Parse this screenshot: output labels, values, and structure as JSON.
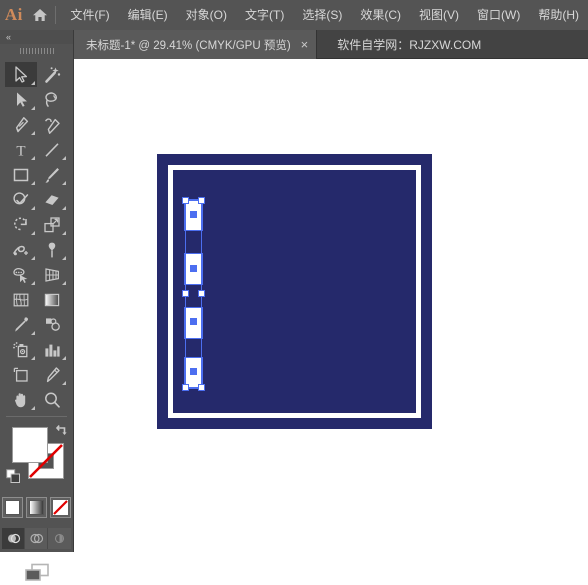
{
  "app": {
    "name": "Adobe Illustrator",
    "logo_text": "Ai",
    "home_icon": "home-icon"
  },
  "menubar": {
    "items": [
      {
        "label": "文件(F)",
        "name": "menu-file"
      },
      {
        "label": "编辑(E)",
        "name": "menu-edit"
      },
      {
        "label": "对象(O)",
        "name": "menu-object"
      },
      {
        "label": "文字(T)",
        "name": "menu-type"
      },
      {
        "label": "选择(S)",
        "name": "menu-select"
      },
      {
        "label": "效果(C)",
        "name": "menu-effect"
      },
      {
        "label": "视图(V)",
        "name": "menu-view"
      },
      {
        "label": "窗口(W)",
        "name": "menu-window"
      },
      {
        "label": "帮助(H)",
        "name": "menu-help"
      }
    ]
  },
  "tabbar": {
    "active_tab": {
      "title": "未标题-1* @ 29.41% (CMYK/GPU 预览)",
      "close_glyph": "×",
      "document_name": "未标题-1",
      "modified": true,
      "zoom": "29.41%",
      "color_mode": "CMYK",
      "preview": "GPU 预览"
    },
    "watermark": "软件自学网：RJZXW.COM"
  },
  "toolpanel": {
    "collapse_glyph": "«",
    "grip": "panel-grip",
    "tools": [
      {
        "name": "selection-tool",
        "label": "选择工具",
        "active": true,
        "corner": true
      },
      {
        "name": "magic-wand-tool",
        "label": "魔棒工具",
        "active": false,
        "corner": false
      },
      {
        "name": "direct-selection-tool",
        "label": "直接选择工具",
        "active": false,
        "corner": true
      },
      {
        "name": "lasso-tool",
        "label": "套索工具",
        "active": false,
        "corner": false
      },
      {
        "name": "pen-tool",
        "label": "钢笔工具",
        "active": false,
        "corner": true
      },
      {
        "name": "curvature-tool",
        "label": "曲率工具",
        "active": false,
        "corner": false
      },
      {
        "name": "type-tool",
        "label": "文字工具",
        "active": false,
        "corner": true
      },
      {
        "name": "line-segment-tool",
        "label": "直线段工具",
        "active": false,
        "corner": true
      },
      {
        "name": "rectangle-tool",
        "label": "矩形工具",
        "active": false,
        "corner": true
      },
      {
        "name": "paintbrush-tool",
        "label": "画笔工具",
        "active": false,
        "corner": true
      },
      {
        "name": "shaper-tool",
        "label": "Shaper 工具",
        "active": false,
        "corner": true
      },
      {
        "name": "eraser-tool",
        "label": "橡皮擦工具",
        "active": false,
        "corner": true
      },
      {
        "name": "rotate-tool",
        "label": "旋转工具",
        "active": false,
        "corner": true
      },
      {
        "name": "scale-tool",
        "label": "比例缩放工具",
        "active": false,
        "corner": true
      },
      {
        "name": "width-tool",
        "label": "宽度工具",
        "active": false,
        "corner": true
      },
      {
        "name": "free-transform-tool",
        "label": "自由变换工具",
        "active": false,
        "corner": true
      },
      {
        "name": "shape-builder-tool",
        "label": "形状生成器工具",
        "active": false,
        "corner": true
      },
      {
        "name": "perspective-grid-tool",
        "label": "透视网格工具",
        "active": false,
        "corner": true
      },
      {
        "name": "mesh-tool",
        "label": "网格工具",
        "active": false,
        "corner": false
      },
      {
        "name": "gradient-tool",
        "label": "渐变工具",
        "active": false,
        "corner": false
      },
      {
        "name": "eyedropper-tool",
        "label": "吸管工具",
        "active": false,
        "corner": true
      },
      {
        "name": "blend-tool",
        "label": "混合工具",
        "active": false,
        "corner": false
      },
      {
        "name": "symbol-sprayer-tool",
        "label": "符号喷枪工具",
        "active": false,
        "corner": true
      },
      {
        "name": "column-graph-tool",
        "label": "柱形图工具",
        "active": false,
        "corner": true
      },
      {
        "name": "artboard-tool",
        "label": "画板工具",
        "active": false,
        "corner": false
      },
      {
        "name": "slice-tool",
        "label": "切片工具",
        "active": false,
        "corner": true
      },
      {
        "name": "hand-tool",
        "label": "抓手工具",
        "active": false,
        "corner": true
      },
      {
        "name": "zoom-tool",
        "label": "缩放工具",
        "active": false,
        "corner": false
      }
    ],
    "fill_stroke": {
      "fill_label": "填色",
      "fill_color": "#ffffff",
      "stroke_label": "描边",
      "stroke_color": "none",
      "swap_icon": "swap-fill-stroke-icon",
      "default_icon": "default-fill-stroke-icon",
      "none_indicator_color": "#e00000",
      "modes": [
        {
          "name": "color-mode-button",
          "label": "颜色",
          "selected": true
        },
        {
          "name": "gradient-mode-button",
          "label": "渐变",
          "selected": false
        },
        {
          "name": "none-mode-button",
          "label": "无",
          "selected": false
        }
      ]
    },
    "screen_modes": [
      {
        "name": "drawing-normal-button",
        "label": "正常绘图",
        "selected": true
      },
      {
        "name": "drawing-behind-button",
        "label": "背面绘图",
        "selected": false
      },
      {
        "name": "drawing-inside-button",
        "label": "内部绘图",
        "selected": false
      }
    ],
    "change_screen_mode": {
      "name": "change-screen-mode-button",
      "label": "更改屏幕模式"
    }
  },
  "canvas": {
    "background": "#ffffff",
    "artwork": {
      "navy_color": "#25296b",
      "white_color": "#ffffff",
      "selection_color": "#4c6ef0",
      "frame_label": "白色边框",
      "bars_label": "选中的白色竖条组",
      "bar_count": 4
    }
  }
}
